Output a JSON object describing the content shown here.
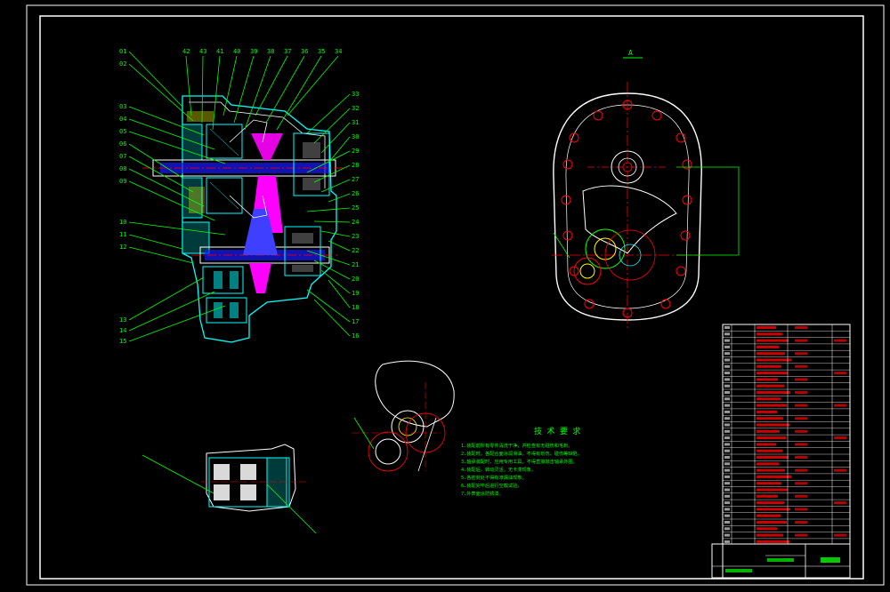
{
  "drawing": {
    "section_label": "A",
    "main_view_title": "",
    "detail_caption": "",
    "notes_title": "技 术 要 求",
    "notes": [
      "1.装配前所有零件清洗干净，并检查有无碰伤和毛刺。",
      "2.装配时，各配合面涂润滑油，不得有划伤、碰伤等缺陷。",
      "3.轴承装配时，应用专用工具，不得直接敲击轴承外圈。",
      "4.装配后，转动灵活，无卡滞现象。",
      "5.各密封处不得有渗漏油现象。",
      "6.装配完毕后进行空载试验。",
      "7.外表面涂防锈漆。"
    ],
    "dimension_text": "",
    "part_numbers_left": [
      "01",
      "02",
      "03",
      "04",
      "05",
      "06",
      "07",
      "08",
      "09",
      "10",
      "11",
      "12",
      "13",
      "14",
      "15"
    ],
    "part_numbers_top": [
      "42",
      "43",
      "41",
      "40",
      "39",
      "38",
      "37",
      "36",
      "35",
      "34"
    ],
    "part_numbers_right": [
      "33",
      "32",
      "31",
      "30",
      "29",
      "28",
      "27",
      "26",
      "25",
      "24",
      "23",
      "22",
      "21",
      "20",
      "19",
      "18",
      "17",
      "16"
    ]
  },
  "colors": {
    "frame": "#ffffff",
    "leader": "#00ff00",
    "housing": "#00ffff",
    "shaft_blue": "#3f3fff",
    "disc": "#ff00ff",
    "center": "#ff0000",
    "yellow": "#ffff00"
  }
}
